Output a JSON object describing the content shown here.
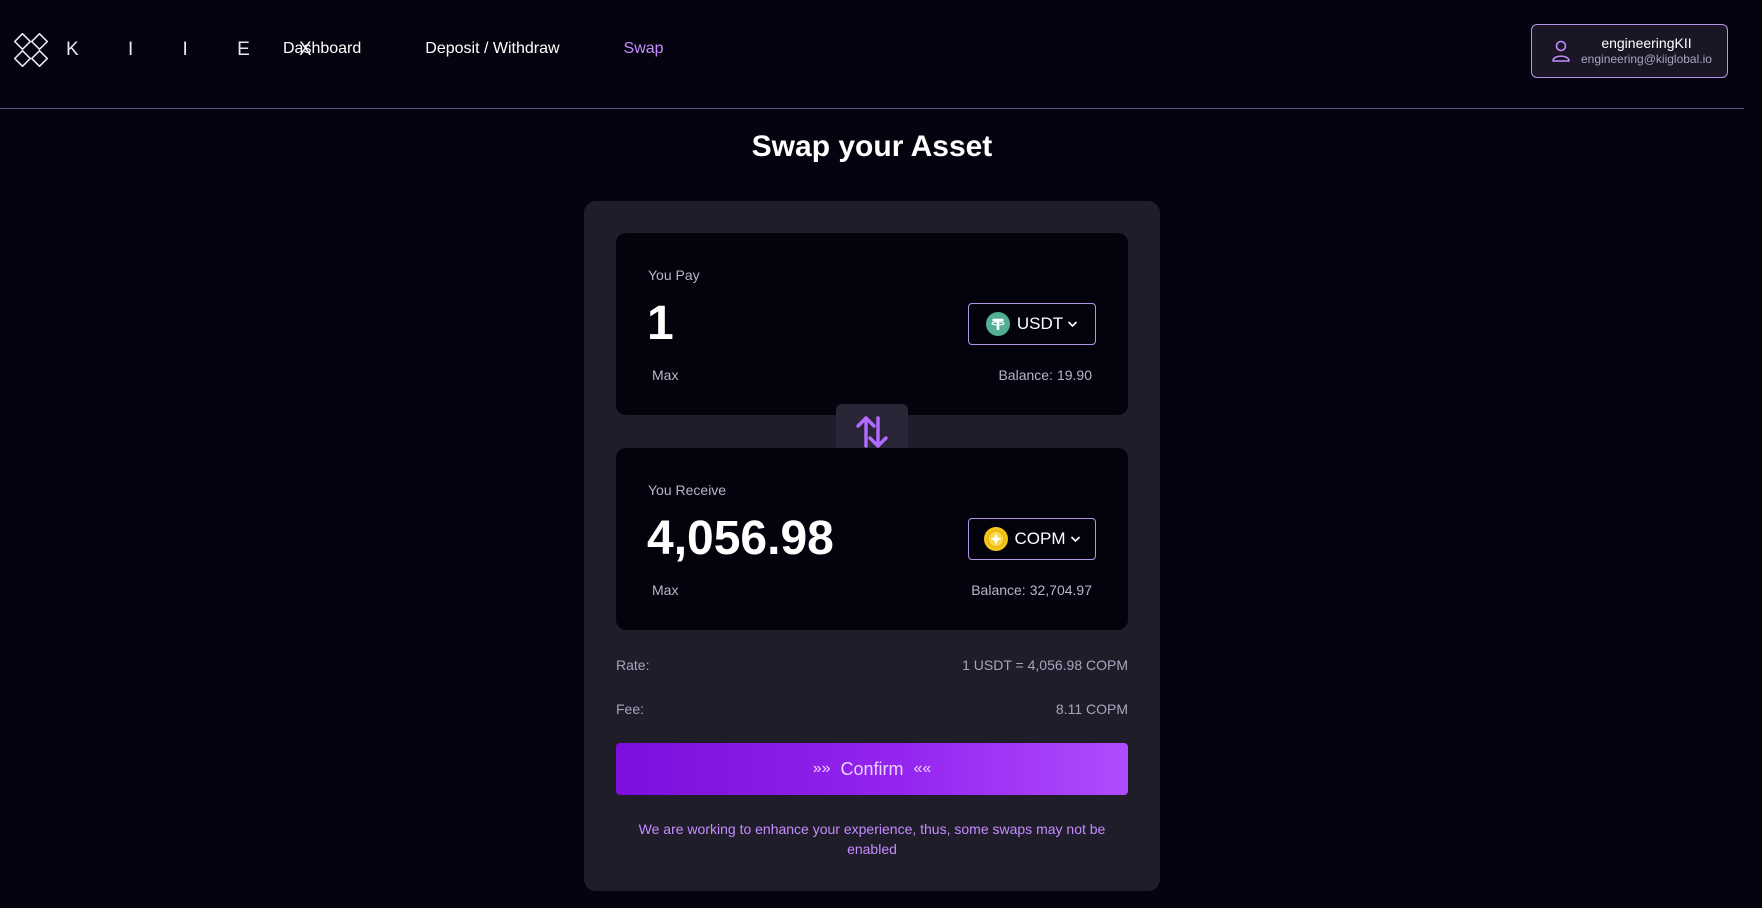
{
  "brand": {
    "name": "K I I E X"
  },
  "nav": {
    "items": [
      {
        "label": "Dashboard"
      },
      {
        "label": "Deposit / Withdraw"
      },
      {
        "label": "Swap"
      }
    ],
    "active": "Swap"
  },
  "user": {
    "name": "engineeringKII",
    "email": "engineering@kiiglobal.io"
  },
  "page": {
    "title": "Swap your Asset"
  },
  "pay": {
    "label": "You Pay",
    "amount": "1",
    "token": "USDT",
    "token_icon": "tether-icon",
    "max_label": "Max",
    "balance_label": "Balance:",
    "balance_value": "19.90"
  },
  "receive": {
    "label": "You Receive",
    "amount": "4,056.98",
    "token": "COPM",
    "token_icon": "copm-coin-icon",
    "max_label": "Max",
    "balance_label": "Balance:",
    "balance_value": "32,704.97"
  },
  "rate": {
    "label": "Rate:",
    "value": "1 USDT = 4,056.98 COPM"
  },
  "fee": {
    "label": "Fee:",
    "value": "8.11 COPM"
  },
  "confirm": {
    "label": "Confirm",
    "left_arrows": "»»",
    "right_arrows": "««"
  },
  "notice": "We are working to enhance your experience, thus, some swaps may not be enabled",
  "colors": {
    "accent": "#c58cff",
    "background": "#05030f",
    "card": "#201d2b",
    "button_start": "#7c0fdc",
    "button_end": "#b04cff"
  }
}
